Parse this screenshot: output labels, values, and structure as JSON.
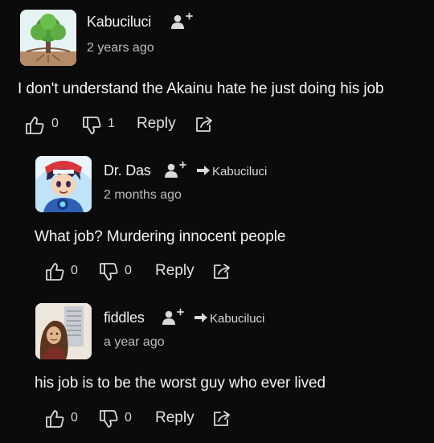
{
  "comments": [
    {
      "author": "Kabuciluci",
      "time": "2 years ago",
      "text": "I don't understand the Akainu hate he just doing his job",
      "likes": "0",
      "dislikes": "1",
      "reply_label": "Reply",
      "avatar_icon": "tree-avatar"
    },
    {
      "author": "Dr. Das",
      "reply_to": "Kabuciluci",
      "time": "2 months ago",
      "text": "What job? Murdering innocent people",
      "likes": "0",
      "dislikes": "0",
      "reply_label": "Reply",
      "avatar_icon": "anime-avatar"
    },
    {
      "author": "fiddles",
      "reply_to": "Kabuciluci",
      "time": "a year ago",
      "text": "his job is to be the worst guy who ever lived",
      "likes": "0",
      "dislikes": "0",
      "reply_label": "Reply",
      "avatar_icon": "person-avatar"
    }
  ],
  "colors": {
    "background": "#0b0b0b",
    "text": "#f3f3f3",
    "muted": "#bdbdbd"
  }
}
